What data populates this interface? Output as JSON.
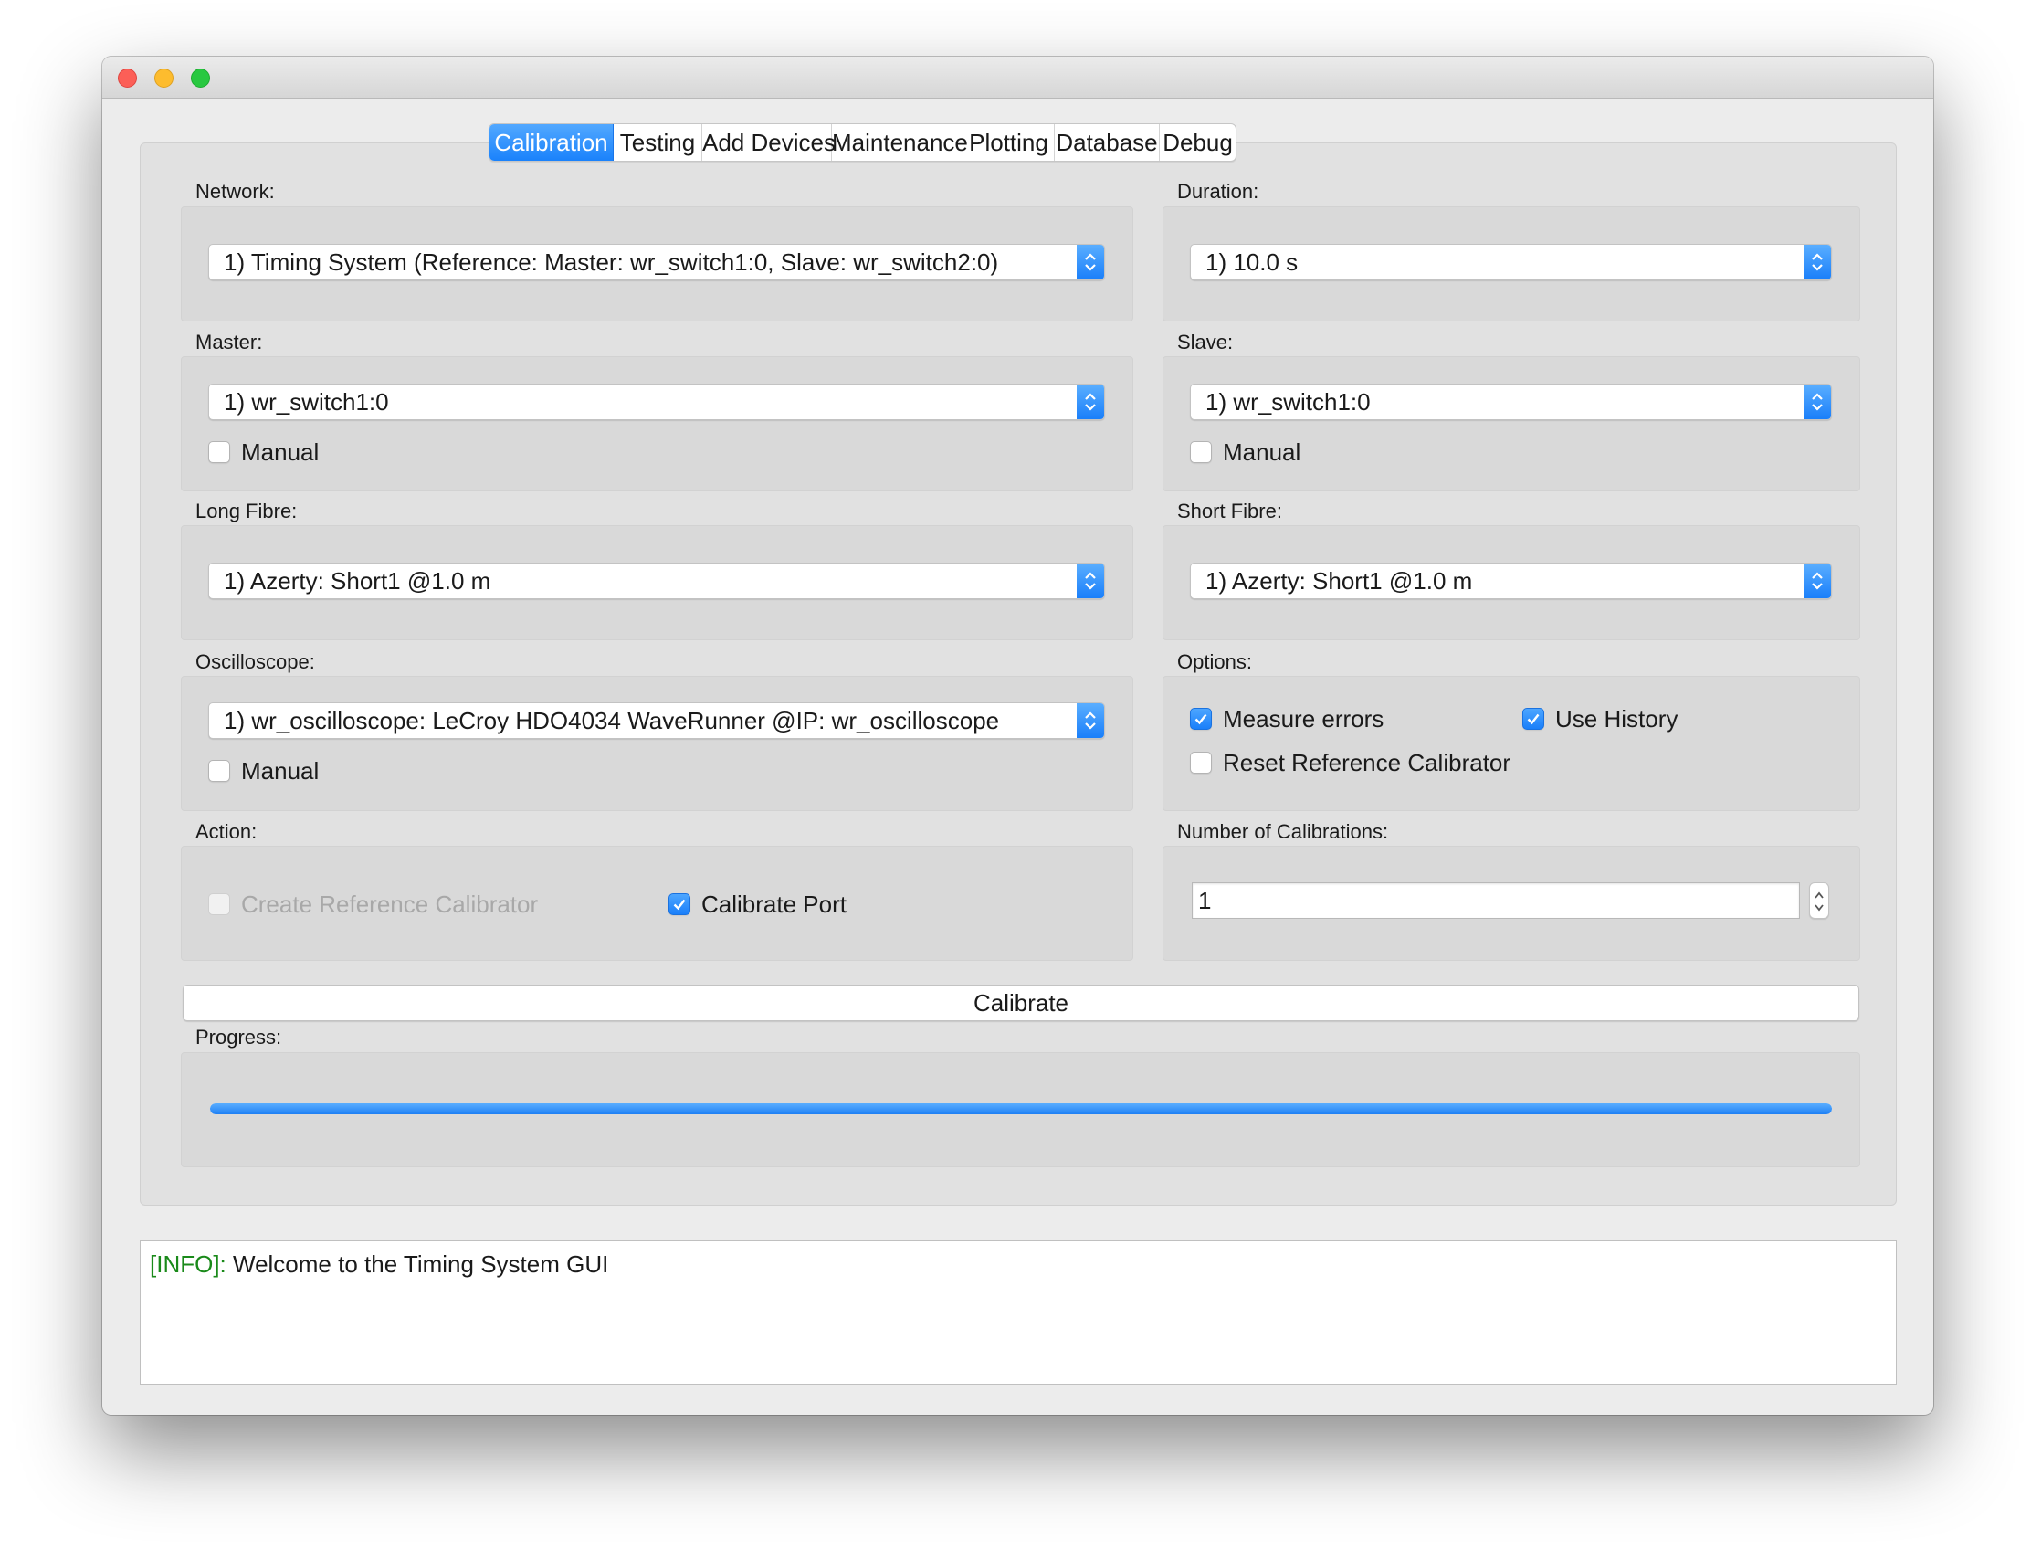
{
  "window": {
    "controls": [
      "close",
      "minimize",
      "zoom"
    ]
  },
  "tabs": [
    {
      "label": "Calibration",
      "active": true
    },
    {
      "label": "Testing",
      "active": false
    },
    {
      "label": "Add Devices",
      "active": false
    },
    {
      "label": "Maintenance",
      "active": false
    },
    {
      "label": "Plotting",
      "active": false
    },
    {
      "label": "Database",
      "active": false
    },
    {
      "label": "Debug",
      "active": false
    }
  ],
  "network": {
    "label": "Network:",
    "value": "1) Timing System (Reference: Master: wr_switch1:0, Slave: wr_switch2:0)"
  },
  "duration": {
    "label": "Duration:",
    "value": "1) 10.0 s"
  },
  "master": {
    "label": "Master:",
    "value": "1) wr_switch1:0",
    "manual_label": "Manual",
    "manual_checked": false
  },
  "slave": {
    "label": "Slave:",
    "value": "1) wr_switch1:0",
    "manual_label": "Manual",
    "manual_checked": false
  },
  "long_fibre": {
    "label": "Long Fibre:",
    "value": "1) Azerty: Short1 @1.0 m"
  },
  "short_fibre": {
    "label": "Short Fibre:",
    "value": "1) Azerty: Short1 @1.0 m"
  },
  "oscilloscope": {
    "label": "Oscilloscope:",
    "value": "1) wr_oscilloscope: LeCroy HDO4034 WaveRunner @IP: wr_oscilloscope",
    "manual_label": "Manual",
    "manual_checked": false
  },
  "options": {
    "label": "Options:",
    "measure_errors": {
      "label": "Measure errors",
      "checked": true
    },
    "use_history": {
      "label": "Use History",
      "checked": true
    },
    "reset_reference": {
      "label": "Reset Reference Calibrator",
      "checked": false
    }
  },
  "action": {
    "label": "Action:",
    "create_reference": {
      "label": "Create Reference Calibrator",
      "checked": false,
      "enabled": false
    },
    "calibrate_port": {
      "label": "Calibrate Port",
      "checked": true
    }
  },
  "num_calibrations": {
    "label": "Number of Calibrations:",
    "value": "1"
  },
  "calibrate_button": "Calibrate",
  "progress": {
    "label": "Progress:",
    "value_percent": 100
  },
  "log": {
    "tag": "[INFO]:",
    "message": " Welcome to the Timing System GUI"
  },
  "colors": {
    "accent": "#1a82fb",
    "info_tag": "#1a8a1a"
  }
}
